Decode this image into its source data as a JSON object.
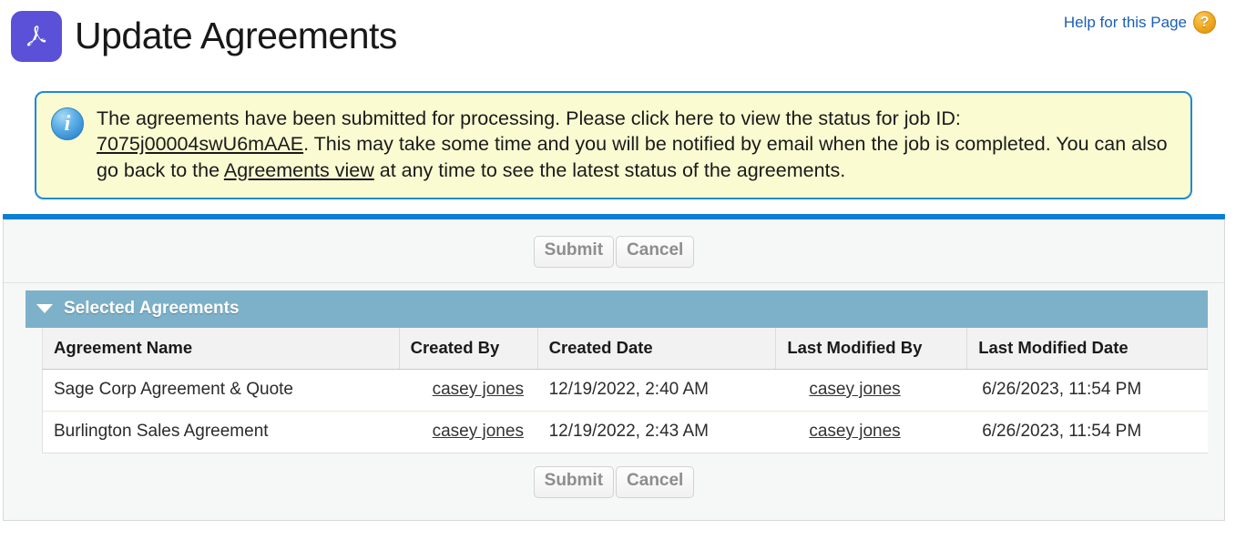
{
  "header": {
    "title": "Update Agreements",
    "app_icon": "adobe-acrobat-icon",
    "help_link": "Help for this Page",
    "help_icon": "question-mark-icon"
  },
  "message": {
    "icon": "info-icon",
    "part1": "The agreements have been submitted for processing. Please click here to view the status for job ID: ",
    "job_id_link": "7075j00004swU6mAAE",
    "part2": ". This may take some time and you will be notified by email when the job is completed. You can also go back to the ",
    "agreements_view_link": "Agreements view",
    "part3": " at any time to see the latest status of the agreements.",
    "background_color": "#fbfbd2",
    "border_color": "#1c8ad6"
  },
  "divider": {
    "color": "#0b7fd4"
  },
  "toolbar": {
    "submit_label": "Submit",
    "cancel_label": "Cancel"
  },
  "section": {
    "title": "Selected Agreements",
    "collapse_icon": "triangle-down-icon",
    "header_color": "#7db1c9"
  },
  "table": {
    "columns": [
      "Agreement Name",
      "Created By",
      "Created Date",
      "Last Modified By",
      "Last Modified Date"
    ],
    "rows": [
      {
        "name": "Sage Corp Agreement & Quote",
        "created_by": "casey jones",
        "created_date": "12/19/2022, 2:40 AM",
        "last_modified_by": "casey jones",
        "last_modified_date": "6/26/2023, 11:54 PM"
      },
      {
        "name": "Burlington Sales Agreement",
        "created_by": "casey jones",
        "created_date": "12/19/2022, 2:43 AM",
        "last_modified_by": "casey jones",
        "last_modified_date": "6/26/2023, 11:54 PM"
      }
    ]
  }
}
